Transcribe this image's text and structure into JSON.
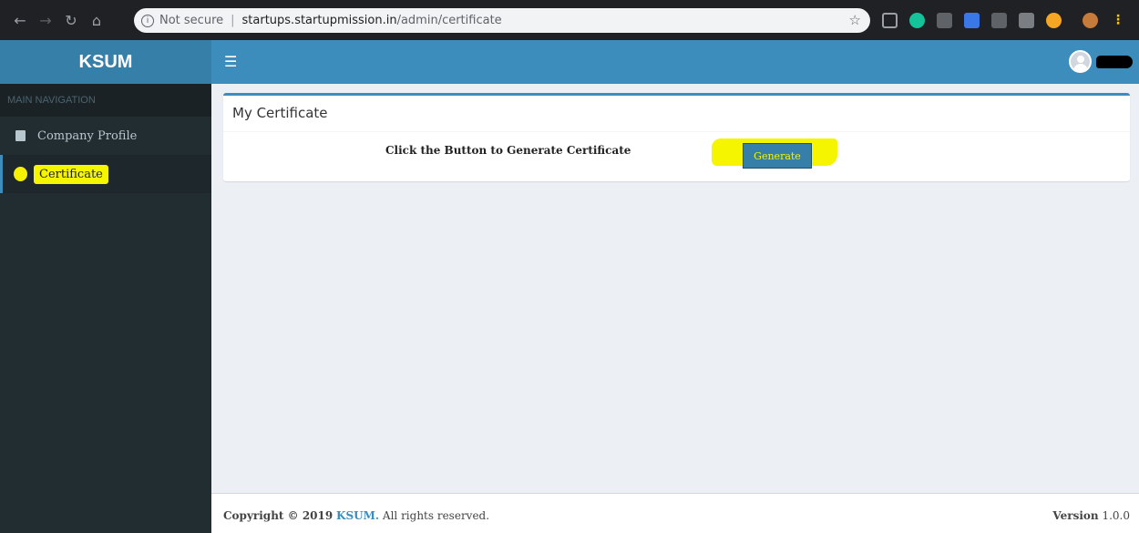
{
  "browser": {
    "not_secure": "Not secure",
    "separator": "|",
    "host": "startups.startupmission.in",
    "path": "/admin/certificate"
  },
  "header": {
    "logo": "KSUM",
    "menu_icon": "hamburger-icon",
    "user_icon": "user-avatar-icon"
  },
  "sidebar": {
    "section_title": "MAIN NAVIGATION",
    "items": [
      {
        "label": "Company Profile",
        "icon": "building-icon",
        "active": false
      },
      {
        "label": "Certificate",
        "icon": "circle-icon",
        "active": true
      }
    ]
  },
  "main": {
    "box_title": "My Certificate",
    "instruction": "Click the Button to Generate Certificate",
    "generate_label": "Generate"
  },
  "footer": {
    "copyright_prefix": "Copyright © 2019",
    "brand": "KSUM.",
    "rights": "All rights reserved.",
    "version_label": "Version",
    "version_value": "1.0.0"
  },
  "colors": {
    "header": "#3c8dbc",
    "logo_bg": "#367fa9",
    "sidebar": "#222d32",
    "content_bg": "#ecf0f5",
    "highlight": "#f5f500"
  }
}
